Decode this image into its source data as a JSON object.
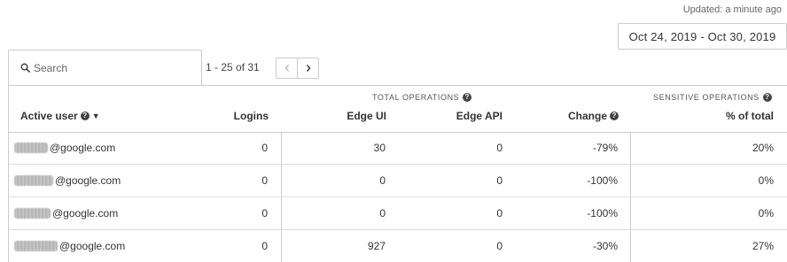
{
  "header": {
    "updated_text": "Updated: a minute ago",
    "date_range": "Oct 24, 2019 - Oct 30, 2019"
  },
  "search": {
    "placeholder": "Search",
    "value": ""
  },
  "pager": {
    "range_text": "1 - 25 of 31",
    "prev_icon": "chevron-left-icon",
    "next_icon": "chevron-right-icon"
  },
  "table": {
    "group_total": "TOTAL OPERATIONS",
    "group_sensitive": "SENSITIVE OPERATIONS",
    "columns": {
      "active_user": "Active user",
      "logins": "Logins",
      "edge_ui": "Edge UI",
      "edge_api": "Edge API",
      "change": "Change",
      "pct_total": "% of total"
    },
    "rows": [
      {
        "email_domain": "@google.com",
        "logins": "0",
        "edge_ui": "30",
        "edge_api": "0",
        "change": "-79%",
        "pct_total": "20%"
      },
      {
        "email_domain": "@google.com",
        "logins": "0",
        "edge_ui": "0",
        "edge_api": "0",
        "change": "-100%",
        "pct_total": "0%"
      },
      {
        "email_domain": "@google.com",
        "logins": "0",
        "edge_ui": "0",
        "edge_api": "0",
        "change": "-100%",
        "pct_total": "0%"
      },
      {
        "email_domain": "@google.com",
        "logins": "0",
        "edge_ui": "927",
        "edge_api": "0",
        "change": "-30%",
        "pct_total": "27%"
      }
    ]
  },
  "colors": {
    "border": "#cccccc",
    "text": "#333333",
    "muted": "#666666"
  }
}
